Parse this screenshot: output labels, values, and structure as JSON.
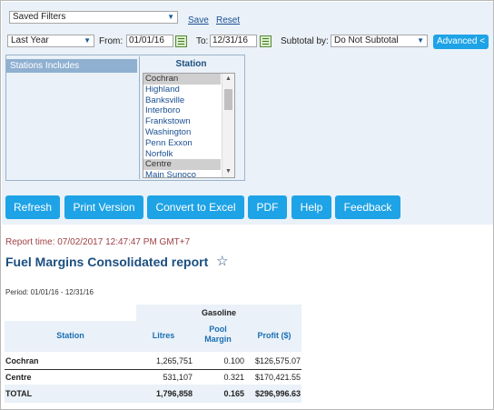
{
  "filters": {
    "saved_filters": "Saved Filters",
    "save_label": "Save",
    "reset_label": "Reset",
    "period_select": "Last Year",
    "from_label": "From:",
    "from_value": "01/01/16",
    "to_label": "To:",
    "to_value": "12/31/16",
    "subtotal_label": "Subtotal by:",
    "subtotal_value": "Do Not Subtotal",
    "advanced_label": "Advanced <",
    "stations_includes": "Stations Includes",
    "station_header": "Station",
    "stations": [
      {
        "name": "Cochran",
        "selected": true
      },
      {
        "name": "Highland",
        "selected": false
      },
      {
        "name": "Banksville",
        "selected": false
      },
      {
        "name": "Interboro",
        "selected": false
      },
      {
        "name": "Frankstown",
        "selected": false
      },
      {
        "name": "Washington",
        "selected": false
      },
      {
        "name": "Penn Exxon",
        "selected": false
      },
      {
        "name": "Norfolk",
        "selected": false
      },
      {
        "name": "Centre",
        "selected": true
      },
      {
        "name": "Main Sunoco",
        "selected": false
      }
    ]
  },
  "actions": {
    "refresh": "Refresh",
    "print": "Print Version",
    "excel": "Convert to Excel",
    "pdf": "PDF",
    "help": "Help",
    "feedback": "Feedback"
  },
  "report": {
    "time": "Report time: 07/02/2017 12:47:47 PM GMT+7",
    "title": "Fuel Margins Consolidated report",
    "star_icon": "☆",
    "period": "Period: 01/01/16 - 12/31/16",
    "group_header": "Gasoline",
    "col_station": "Station",
    "col_litres": "Litres",
    "col_margin_1": "Pool",
    "col_margin_2": "Margin",
    "col_profit": "Profit ($)",
    "rows": [
      {
        "station": "Cochran",
        "litres": "1,265,751",
        "margin": "0.100",
        "profit": "$126,575.07"
      },
      {
        "station": "Centre",
        "litres": "531,107",
        "margin": "0.321",
        "profit": "$170,421.55"
      }
    ],
    "total": {
      "station": "TOTAL",
      "litres": "1,796,858",
      "margin": "0.165",
      "profit": "$296,996.63"
    }
  },
  "colors": {
    "accent": "#1ea3e6",
    "panel_bg": "#eaf1f8",
    "title": "#1b4f80",
    "report_time": "#a04046"
  }
}
